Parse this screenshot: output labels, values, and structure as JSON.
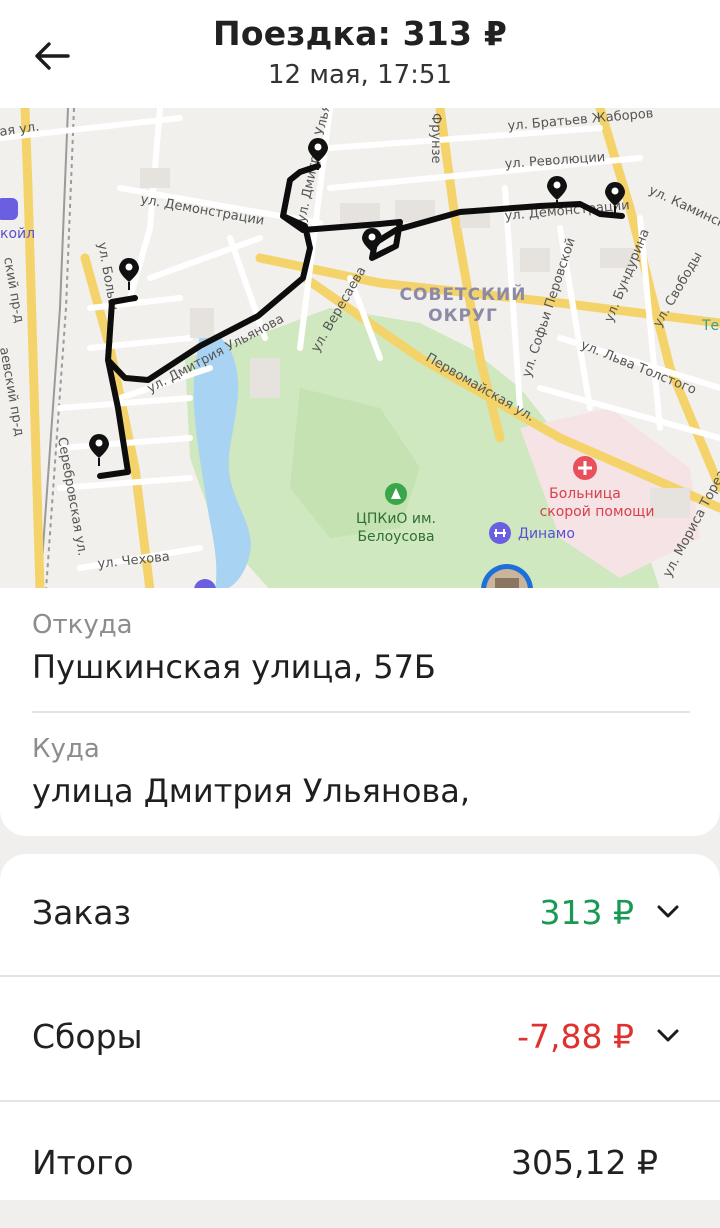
{
  "header": {
    "title": "Поездка: 313 ₽",
    "subtitle": "12 мая, 17:51"
  },
  "map": {
    "streets": {
      "bratyev_zhabrov": "ул. Братьев Жаборов",
      "revolyutsii": "ул. Революции",
      "demonstratsii_left": "ул. Демонстрации",
      "demonstratsii_right": "ул. Демонстрации",
      "kaminskogo": "ул. Каминск",
      "dmitriya_ulyanova_top": "ул. Дмитрия Ульянова",
      "dmitriya_ulyanova_bottom": "ул. Дмитрия Ульянова",
      "bolshaya": "ул. Больш",
      "veresaeva": "ул. Вересаева",
      "pervomaiskaya": "Первомайская ул.",
      "sofi_perovskoi": "ул. Софьи Перовской",
      "bundurina": "ул. Бундурина",
      "svobody": "ул. Свободы",
      "lva_tolstogo": "ул. Льва Толстого",
      "chekhova": "ул. Чехова",
      "serebrovskaya": "Серебровская ул.",
      "morisa_toreza": "ул. Мориса Тореза",
      "fruzhe": "Фрунзе",
      "top_left_partial": "ая ул.",
      "left_partial": "ский пр-д",
      "left_partial2": "аевский пр-д"
    },
    "district": [
      "СОВЕТСКИЙ",
      "ОКРУГ"
    ],
    "pois": {
      "park": [
        "ЦПКиО им.",
        "Белоусова"
      ],
      "hospital": [
        "Больница",
        "скорой помощи"
      ],
      "dynamo": "Динамо",
      "left_poi": "койл",
      "right_edge": "Те"
    },
    "route_color": "#0d0d0d",
    "park_color": "#cfe8bf",
    "water_color": "#a8d3f2"
  },
  "trip": {
    "from_label": "Откуда",
    "from_value": "Пушкинская улица, 57Б",
    "to_label": "Куда",
    "to_value": "улица Дмитрия Ульянова,"
  },
  "fare": {
    "order_label": "Заказ",
    "order_value": "313 ₽",
    "order_color": "#1a9954",
    "fees_label": "Сборы",
    "fees_value": "-7,88 ₽",
    "fees_color": "#e03131",
    "total_label": "Итого",
    "total_value": "305,12 ₽"
  }
}
